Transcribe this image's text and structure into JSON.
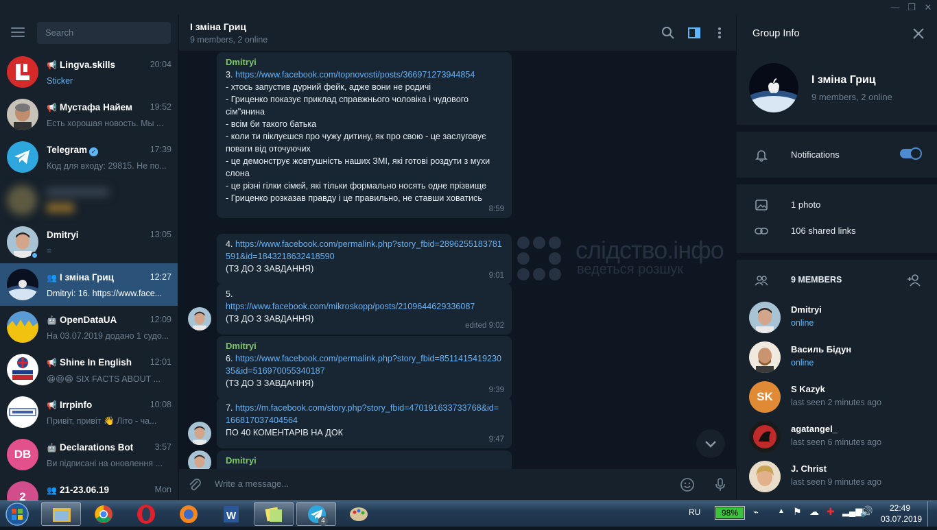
{
  "search": {
    "placeholder": "Search"
  },
  "chats": [
    {
      "name": "Lingva.skills",
      "time": "20:04",
      "preview": "Sticker",
      "type": "channel",
      "accent": true
    },
    {
      "name": "Мустафа Найем",
      "time": "19:52",
      "preview": "Есть хорошая новость. Мы ...",
      "type": "channel"
    },
    {
      "name": "Telegram",
      "time": "17:39",
      "preview": "Код для входу: 29815. Не по...",
      "type": "user",
      "verified": true
    },
    {
      "name": "",
      "time": "",
      "preview": "",
      "type": "blurred"
    },
    {
      "name": "Dmitryi",
      "time": "13:05",
      "preview": "=",
      "type": "user"
    },
    {
      "name": "І зміна Гриц",
      "time": "12:27",
      "preview": "Dmitryi: 16. https://www.face...",
      "type": "group",
      "active": true
    },
    {
      "name": "OpenDataUA",
      "time": "12:09",
      "preview": "На 03.07.2019 додано 1 судо...",
      "type": "bot-channel"
    },
    {
      "name": "Shine In English",
      "time": "12:01",
      "preview": "😀😃😁 SIX FACTS ABOUT ...",
      "type": "channel"
    },
    {
      "name": "Irrpinfo",
      "time": "10:08",
      "preview": "Привіт, привіт 👋 Літо - ча...",
      "type": "channel"
    },
    {
      "name": "Declarations Bot",
      "time": "3:57",
      "preview": "Ви підписані на оновлення ...",
      "type": "bot",
      "initials": "DB"
    },
    {
      "name": "21-23.06.19",
      "time": "Mon",
      "preview": "",
      "type": "group",
      "initials": "2"
    }
  ],
  "chat": {
    "title": "І зміна Гриц",
    "subtitle": "9 members, 2 online",
    "compose_placeholder": "Write a message...",
    "messages": [
      {
        "sender": "Dmitryi",
        "num": "3.",
        "link": "https://www.facebook.com/topnovosti/posts/366971273944854",
        "lines": [
          "- хтось запустив дурний фейк, адже вони не родичі",
          "- Гриценко показує приклад справжнього чоловіка і чудового сім\"янина",
          "- всім би такого батька",
          "- коли ти піклуєшся про чужу дитину, як про свою - це заслуговує поваги від оточуючих",
          "- це демонструє жовтушність наших ЗМІ, які готові роздути з мухи слона",
          "- це різні гілки сімей, які тільки формально носять одне прізвище",
          "- Гриценко розказав правду і це правильно, не ставши ховатись"
        ],
        "time": "8:59"
      },
      {
        "num": "4.",
        "link": "https://www.facebook.com/permalink.php?story_fbid=2896255183781591&id=1843218632418590",
        "lines": [
          "(ТЗ ДО З ЗАВДАННЯ)"
        ],
        "time": "9:01"
      },
      {
        "num": "5.",
        "link": "https://www.facebook.com/mikroskopp/posts/2109644629336087",
        "lines": [
          "(ТЗ ДО З ЗАВДАННЯ)"
        ],
        "time": "edited 9:02"
      },
      {
        "sender": "Dmitryi",
        "num": "6.",
        "link": "https://www.facebook.com/permalink.php?story_fbid=851141541923035&id=516970055340187",
        "lines": [
          "(ТЗ ДО З ЗАВДАННЯ)"
        ],
        "time": "9:39"
      },
      {
        "num": "7.",
        "link": "https://m.facebook.com/story.php?story_fbid=470191633733768&id=166817037404564",
        "lines": [
          "ПО 40 КОМЕНТАРІВ НА ДОК"
        ],
        "time": "9:47"
      },
      {
        "sender": "Dmitryi"
      }
    ],
    "watermark": {
      "title": "слідство.інфо",
      "subtitle": "ведеться розшук"
    }
  },
  "info": {
    "header": "Group Info",
    "name": "І зміна Гриц",
    "subtitle": "9 members, 2 online",
    "notifications_label": "Notifications",
    "notifications_on": true,
    "photos_label": "1 photo",
    "links_label": "106 shared links",
    "members_header": "9 MEMBERS",
    "members": [
      {
        "name": "Dmitryi",
        "status": "online",
        "online": true
      },
      {
        "name": "Василь Бідун",
        "status": "online",
        "online": true
      },
      {
        "name": "S Kazyk",
        "status": "last seen 2 minutes ago",
        "initials": "SK",
        "color": "#e08a36"
      },
      {
        "name": "agatangel_",
        "status": "last seen 6 minutes ago"
      },
      {
        "name": "J. Christ",
        "status": "last seen 9 minutes ago"
      }
    ]
  },
  "taskbar": {
    "language": "RU",
    "battery": "98%",
    "time": "22:49",
    "date": "03.07.2019",
    "telegram_badge": "4"
  }
}
